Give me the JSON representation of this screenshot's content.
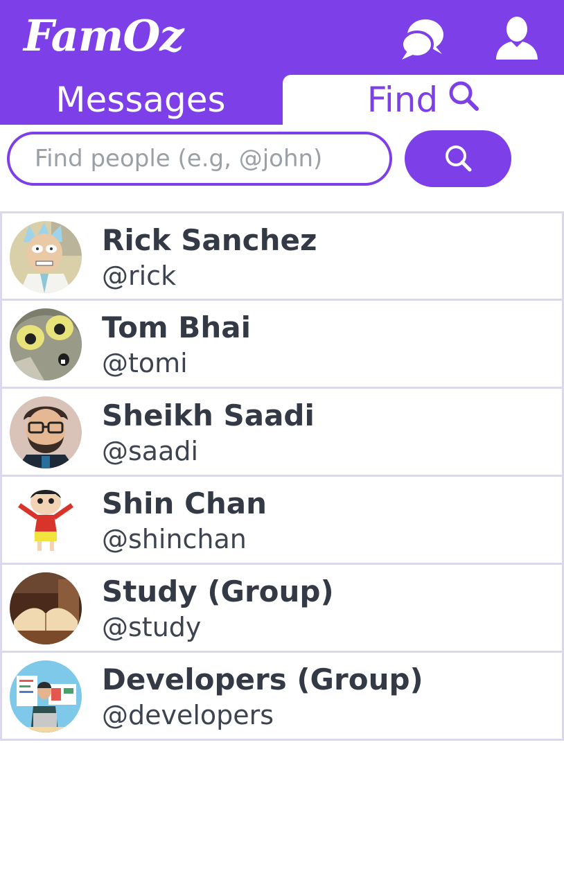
{
  "brand": {
    "name": "FamOz",
    "color": "#7c3fe8"
  },
  "header": {
    "icons": [
      "chat-bubbles-icon",
      "user-icon"
    ]
  },
  "tabs": [
    {
      "label": "Messages",
      "active": false
    },
    {
      "label": "Find",
      "active": true,
      "icon": "search-icon"
    }
  ],
  "search": {
    "placeholder": "Find people (e.g, @john)",
    "value": "",
    "button_icon": "search-icon"
  },
  "people": [
    {
      "name": "Rick Sanchez",
      "handle": "@rick",
      "avatar": "rick-avatar"
    },
    {
      "name": "Tom Bhai",
      "handle": "@tomi",
      "avatar": "tom-avatar"
    },
    {
      "name": "Sheikh Saadi",
      "handle": "@saadi",
      "avatar": "saadi-avatar"
    },
    {
      "name": "Shin Chan",
      "handle": "@shinchan",
      "avatar": "shinchan-avatar"
    },
    {
      "name": "Study (Group)",
      "handle": "@study",
      "avatar": "study-avatar"
    },
    {
      "name": "Developers (Group)",
      "handle": "@developers",
      "avatar": "developers-avatar"
    }
  ]
}
